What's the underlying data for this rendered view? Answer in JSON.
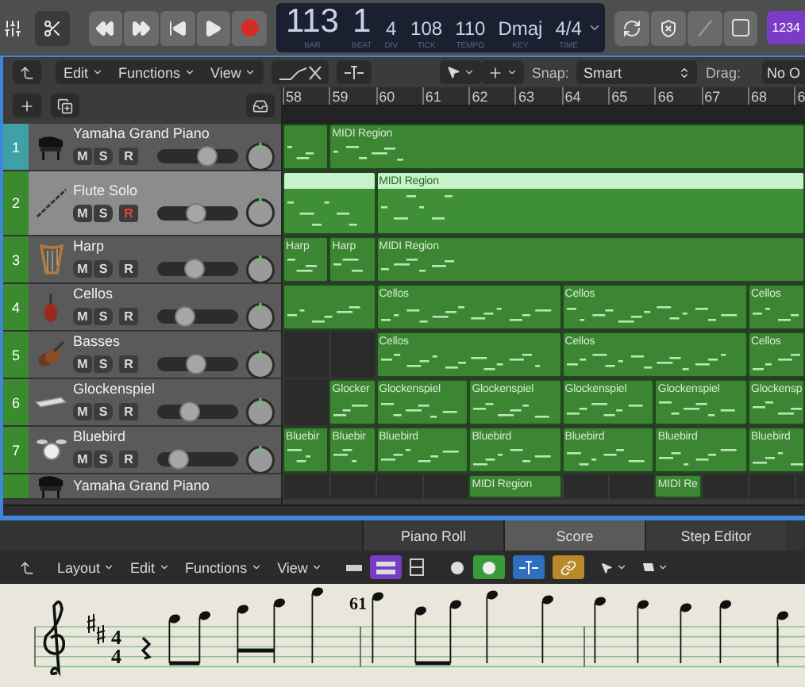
{
  "lcd": [
    {
      "value": "113",
      "label": "BAR"
    },
    {
      "value": "1",
      "label": "BEAT"
    },
    {
      "value": "4",
      "label": "DIV"
    },
    {
      "value": "108",
      "label": "TICK"
    },
    {
      "value": "110",
      "label": "TEMPO"
    },
    {
      "value": "Dmaj",
      "label": "KEY"
    },
    {
      "value": "4/4",
      "label": "TIME"
    }
  ],
  "mode_badge": "1234",
  "toolbar": {
    "menus": [
      "Edit",
      "Functions",
      "View"
    ],
    "snap_label": "Snap:",
    "snap_value": "Smart",
    "drag_label": "Drag:",
    "drag_value": "No O"
  },
  "ruler": [
    "58",
    "59",
    "60",
    "61",
    "62",
    "63",
    "64",
    "65",
    "66",
    "67",
    "68",
    "6"
  ],
  "tracks": [
    {
      "number": "1",
      "name": "Yamaha Grand Piano",
      "kind": "piano",
      "buttons": [
        "M",
        "S",
        "R"
      ],
      "color": "#3fa0a6",
      "selected": false,
      "armed": false,
      "level": 0.6,
      "regions": [
        {
          "kind": "region",
          "selected": false
        },
        {
          "kind": "region",
          "name": "MIDI Region",
          "selected": false
        }
      ]
    },
    {
      "number": "2",
      "name": "Flute Solo",
      "kind": "flute",
      "buttons": [
        "M",
        "S",
        "R"
      ],
      "color": "#3a8a2e",
      "selected": true,
      "armed": true,
      "level": 0.47,
      "regions": [
        {
          "kind": "region",
          "selected": true
        },
        {
          "kind": "region",
          "name": "MIDI Region",
          "selected": true
        }
      ]
    },
    {
      "number": "3",
      "name": "Harp",
      "kind": "harp",
      "buttons": [
        "M",
        "S",
        "R"
      ],
      "color": "#3a8a2e",
      "selected": false,
      "armed": false,
      "level": 0.45,
      "regions": [
        {
          "kind": "region",
          "name": "Harp",
          "selected": false
        },
        {
          "kind": "region",
          "name": "Harp",
          "selected": false
        },
        {
          "kind": "region",
          "name": "MIDI Region",
          "selected": false
        }
      ]
    },
    {
      "number": "4",
      "name": "Cellos",
      "kind": "cello",
      "buttons": [
        "M",
        "S",
        "R"
      ],
      "color": "#3a8a2e",
      "selected": false,
      "armed": false,
      "level": 0.33,
      "regions": [
        {
          "kind": "region",
          "selected": false
        },
        {
          "kind": "region",
          "name": "Cellos",
          "selected": false
        },
        {
          "kind": "region",
          "name": "Cellos",
          "selected": false
        },
        {
          "kind": "region",
          "name": "Cellos",
          "selected": false
        }
      ]
    },
    {
      "number": "5",
      "name": "Basses",
      "kind": "violins",
      "buttons": [
        "M",
        "S",
        "R"
      ],
      "color": "#3a8a2e",
      "selected": false,
      "armed": false,
      "level": 0.47,
      "regions": [
        {
          "kind": "gap"
        },
        {
          "kind": "region",
          "name": "Cellos",
          "selected": false
        },
        {
          "kind": "region",
          "name": "Cellos",
          "selected": false
        },
        {
          "kind": "region",
          "name": "Cellos",
          "selected": false
        }
      ]
    },
    {
      "number": "6",
      "name": "Glockenspiel",
      "kind": "glockenspiel",
      "buttons": [
        "M",
        "S",
        "R"
      ],
      "color": "#3a8a2e",
      "selected": false,
      "armed": false,
      "level": 0.4,
      "regions": [
        {
          "kind": "gap"
        },
        {
          "kind": "region",
          "name": "Glocker",
          "selected": false
        },
        {
          "kind": "region",
          "name": "Glockenspiel",
          "selected": false
        },
        {
          "kind": "region",
          "name": "Glockenspiel",
          "selected": false
        },
        {
          "kind": "region",
          "name": "Glockenspiel",
          "selected": false
        },
        {
          "kind": "region",
          "name": "Glockenspiel",
          "selected": false
        },
        {
          "kind": "region",
          "name": "Glockensp",
          "selected": false
        }
      ]
    },
    {
      "number": "7",
      "name": "Bluebird",
      "kind": "drums",
      "buttons": [
        "M",
        "S",
        "R"
      ],
      "color": "#3a8a2e",
      "selected": false,
      "armed": false,
      "level": 0.25,
      "regions": [
        {
          "kind": "region",
          "name": "Bluebir",
          "selected": false
        },
        {
          "kind": "region",
          "name": "Bluebir",
          "selected": false
        },
        {
          "kind": "region",
          "name": "Bluebird",
          "selected": false
        },
        {
          "kind": "region",
          "name": "Bluebird",
          "selected": false
        },
        {
          "kind": "region",
          "name": "Bluebird",
          "selected": false
        },
        {
          "kind": "region",
          "name": "Bluebird",
          "selected": false
        },
        {
          "kind": "region",
          "name": "Bluebird",
          "selected": false
        }
      ]
    },
    {
      "name": "Yamaha Grand Piano",
      "kind": "piano",
      "regions": [
        {
          "kind": "gap"
        },
        {
          "kind": "region",
          "name": "MIDI Region",
          "selected": false
        },
        {
          "kind": "gap"
        },
        {
          "kind": "region",
          "name": "MIDI Re",
          "selected": false
        }
      ]
    }
  ],
  "editor_tabs": [
    {
      "label": "Piano Roll",
      "selected": false
    },
    {
      "label": "Score",
      "selected": true
    },
    {
      "label": "Step Editor",
      "selected": false
    }
  ],
  "editor_menus": [
    "Layout",
    "Edit",
    "Functions",
    "View"
  ],
  "score": {
    "measure_number": "61",
    "time_signature": [
      "4",
      "4"
    ]
  }
}
